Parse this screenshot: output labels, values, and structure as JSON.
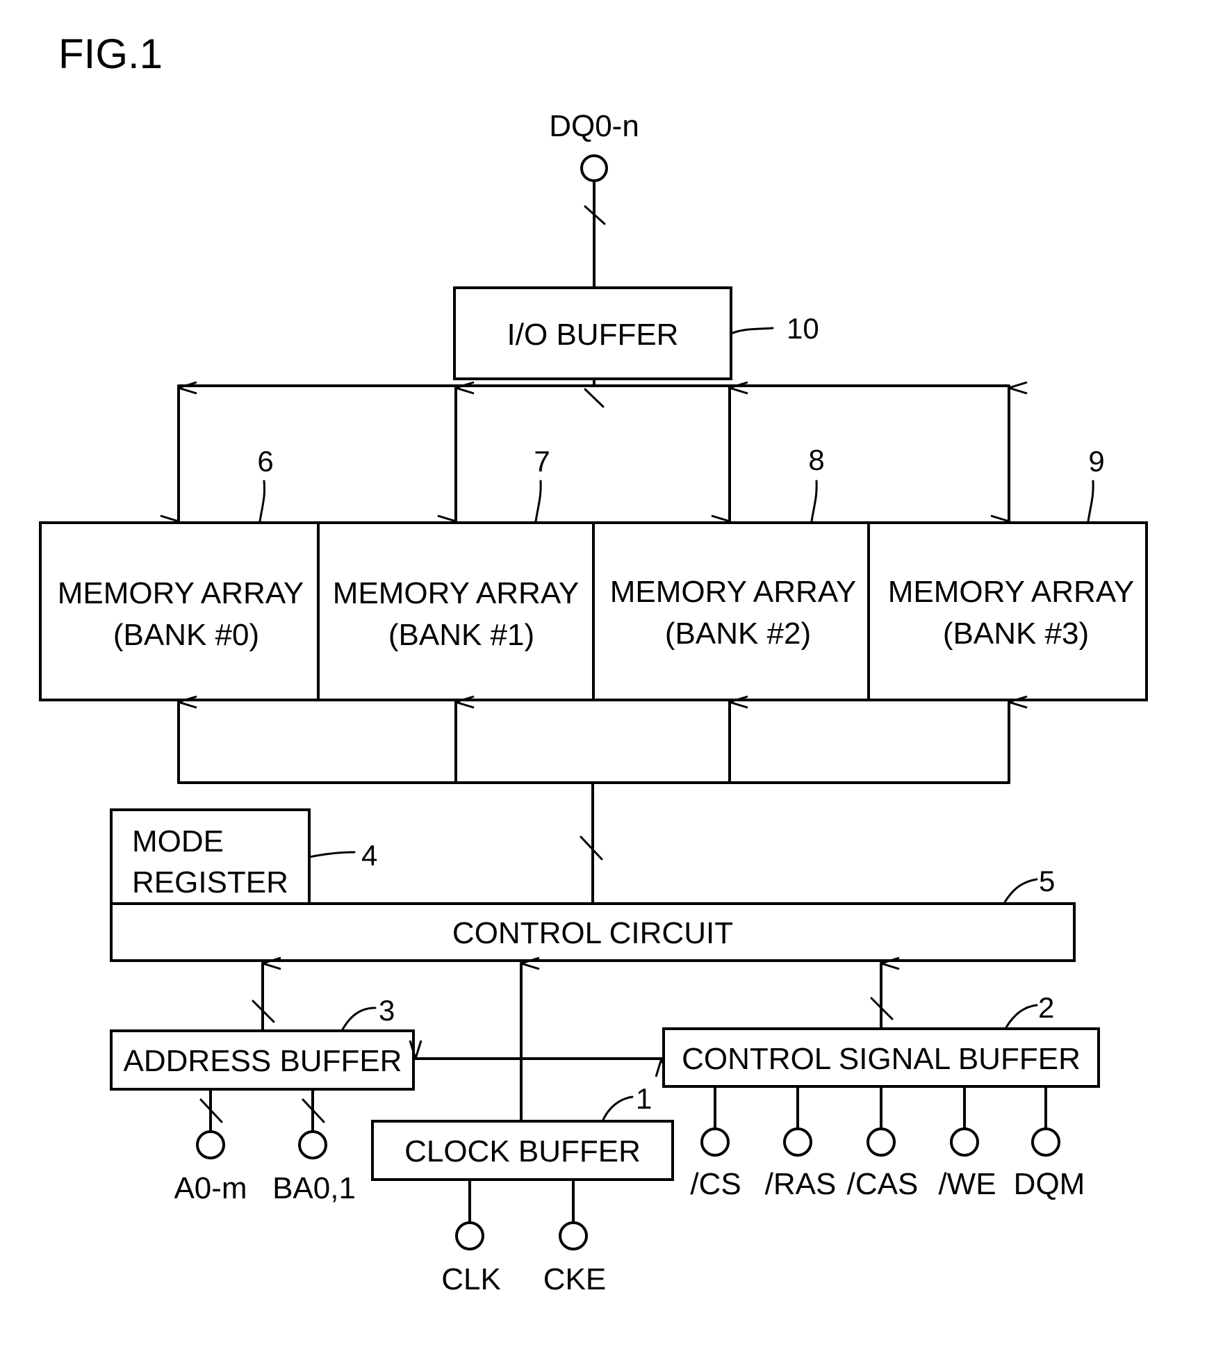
{
  "figure": {
    "title": "FIG.1",
    "colors": {
      "line": "#000000",
      "background": "#ffffff"
    }
  },
  "blocks": {
    "io_buffer": {
      "label": "I/O BUFFER",
      "ref": "10"
    },
    "memory_arrays": [
      {
        "line1": "MEMORY ARRAY",
        "line2": "(BANK #0)",
        "ref": "6"
      },
      {
        "line1": "MEMORY ARRAY",
        "line2": "(BANK #1)",
        "ref": "7"
      },
      {
        "line1": "MEMORY ARRAY",
        "line2": "(BANK #2)",
        "ref": "8"
      },
      {
        "line1": "MEMORY ARRAY",
        "line2": "(BANK #3)",
        "ref": "9"
      }
    ],
    "mode_register": {
      "line1": "MODE",
      "line2": "REGISTER",
      "ref": "4"
    },
    "control_circuit": {
      "label": "CONTROL CIRCUIT",
      "ref": "5"
    },
    "address_buffer": {
      "label": "ADDRESS BUFFER",
      "ref": "3"
    },
    "control_signal_buffer": {
      "label": "CONTROL SIGNAL BUFFER",
      "ref": "2"
    },
    "clock_buffer": {
      "label": "CLOCK BUFFER",
      "ref": "1"
    }
  },
  "pins": {
    "data": "DQ0-n",
    "address": [
      "A0-m",
      "BA0,1"
    ],
    "clock": [
      "CLK",
      "CKE"
    ],
    "control": [
      "/CS",
      "/RAS",
      "/CAS",
      "/WE",
      "DQM"
    ]
  }
}
